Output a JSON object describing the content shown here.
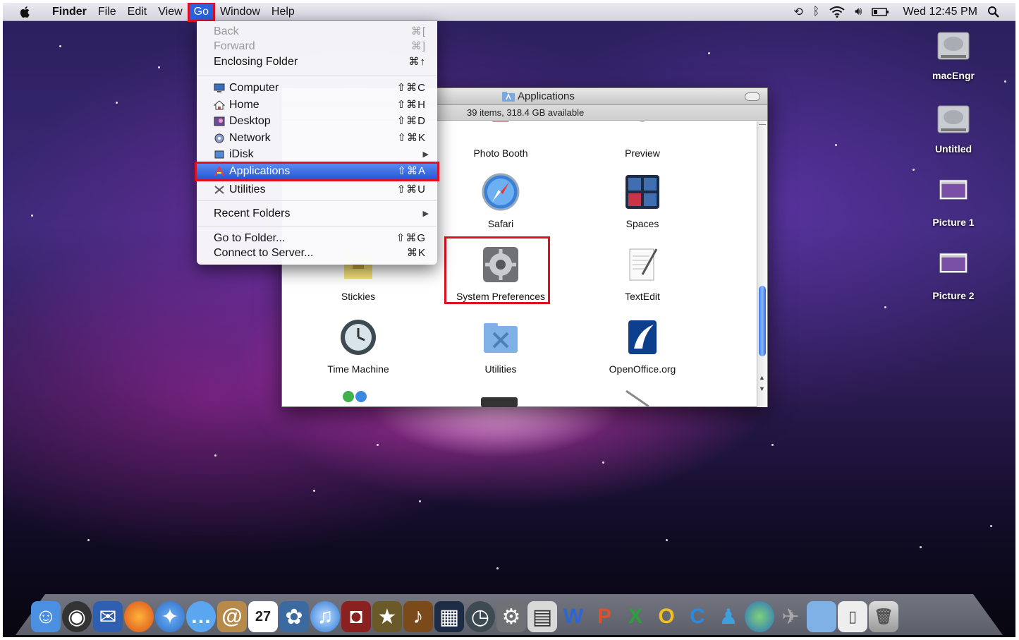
{
  "menubar": {
    "items": [
      "Finder",
      "File",
      "Edit",
      "View",
      "Go",
      "Window",
      "Help"
    ],
    "active": "Go",
    "clock": "Wed 12:45 PM",
    "status_icons": [
      "time-machine-icon",
      "bluetooth-icon",
      "wifi-icon",
      "volume-icon",
      "battery-icon",
      "spotlight-icon"
    ]
  },
  "go_menu": {
    "items": [
      {
        "label": "Back",
        "shortcut": "⌘[",
        "disabled": true
      },
      {
        "label": "Forward",
        "shortcut": "⌘]",
        "disabled": true
      },
      {
        "label": "Enclosing Folder",
        "shortcut": "⌘↑"
      },
      {
        "label": "Computer",
        "shortcut": "⇧⌘C",
        "icon": "computer-icon"
      },
      {
        "label": "Home",
        "shortcut": "⇧⌘H",
        "icon": "home-icon"
      },
      {
        "label": "Desktop",
        "shortcut": "⇧⌘D",
        "icon": "desktop-icon"
      },
      {
        "label": "Network",
        "shortcut": "⇧⌘K",
        "icon": "network-icon"
      },
      {
        "label": "iDisk",
        "shortcut": "▶",
        "icon": "idisk-icon"
      },
      {
        "label": "Applications",
        "shortcut": "⇧⌘A",
        "icon": "applications-icon",
        "selected": true
      },
      {
        "label": "Utilities",
        "shortcut": "⇧⌘U",
        "icon": "utilities-icon"
      },
      {
        "label": "Recent Folders",
        "shortcut": "▶"
      },
      {
        "label": "Go to Folder...",
        "shortcut": "⇧⌘G"
      },
      {
        "label": "Connect to Server...",
        "shortcut": "⌘K"
      }
    ]
  },
  "finder": {
    "title": "Applications",
    "status": "39 items, 318.4 GB available",
    "apps": [
      {
        "label": "Photo Booth",
        "icon": "photo-booth-icon"
      },
      {
        "label": "Preview",
        "icon": "preview-icon"
      },
      {
        "label": "Safari",
        "icon": "safari-icon"
      },
      {
        "label": "Spaces",
        "icon": "spaces-icon"
      },
      {
        "label": "Stickies",
        "icon": "stickies-icon"
      },
      {
        "label": "System Preferences",
        "icon": "system-preferences-icon",
        "highlighted": true
      },
      {
        "label": "TextEdit",
        "icon": "textedit-icon"
      },
      {
        "label": "Time Machine",
        "icon": "time-machine-icon"
      },
      {
        "label": "Utilities",
        "icon": "utilities-folder-icon"
      },
      {
        "label": "OpenOffice.org",
        "icon": "openoffice-icon"
      }
    ]
  },
  "desktop_icons": [
    {
      "label": "macEngr",
      "icon": "hard-drive-icon"
    },
    {
      "label": "Untitled",
      "icon": "hard-drive-icon"
    },
    {
      "label": "Picture 1",
      "icon": "picture-file-icon"
    },
    {
      "label": "Picture 2",
      "icon": "picture-file-icon"
    }
  ],
  "dock": {
    "items": [
      "finder",
      "dashboard",
      "mail-stamp",
      "firefox",
      "safari",
      "ichat",
      "address-book",
      "ical",
      "iphoto",
      "itunes",
      "photo-booth",
      "imovie",
      "garageband",
      "spaces",
      "time-machine",
      "system-preferences",
      "spreadsheet",
      "word",
      "powerpoint",
      "excel",
      "openoffice",
      "c-app",
      "messenger",
      "globe",
      "utility",
      "folder",
      "documents",
      "trash"
    ]
  },
  "colors": {
    "menu_highlight": "#2558d6",
    "annotation_box": "#e01020"
  }
}
